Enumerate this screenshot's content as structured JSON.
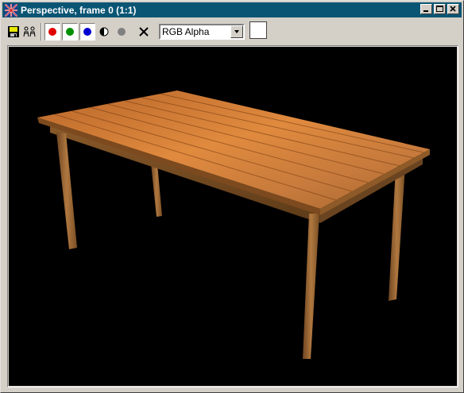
{
  "window": {
    "title": "Perspective, frame 0 (1:1)",
    "title_bar_color": "#0a5574"
  },
  "toolbar": {
    "buttons": [
      {
        "name": "save-icon"
      },
      {
        "name": "clone-icon"
      },
      {
        "name": "red-channel",
        "color": "#e00000"
      },
      {
        "name": "green-channel",
        "color": "#009000"
      },
      {
        "name": "blue-channel",
        "color": "#0000d0"
      },
      {
        "name": "alpha-channel-icon"
      },
      {
        "name": "mono-channel",
        "color": "#808080"
      },
      {
        "name": "clear-icon"
      }
    ],
    "channel_select": {
      "selected": "RGB Alpha"
    },
    "swatch_color": "#ffffff"
  },
  "viewport": {
    "background": "#000000",
    "content": "render-wooden-table"
  }
}
